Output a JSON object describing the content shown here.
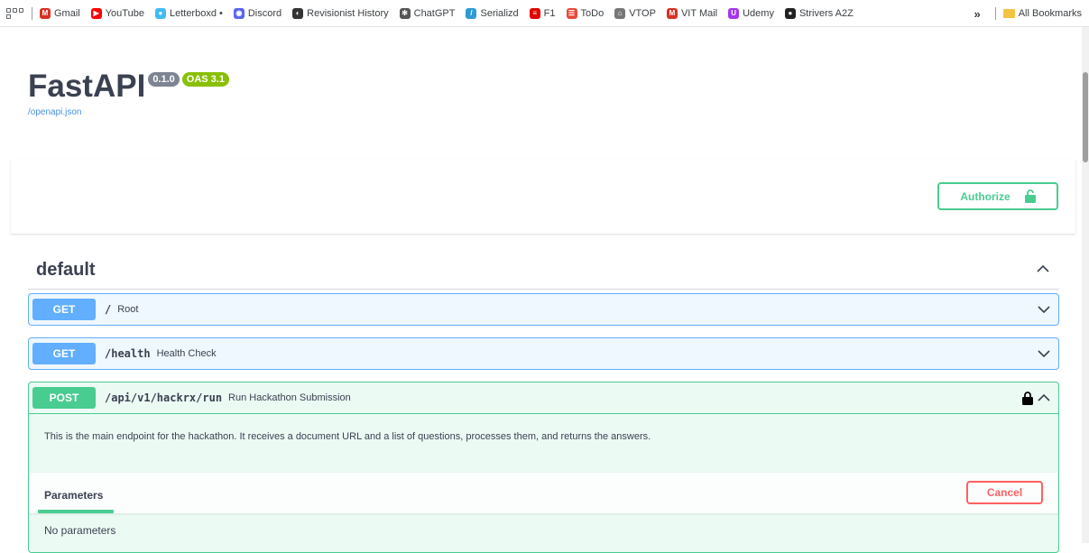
{
  "bookmarks": {
    "items": [
      {
        "label": "Gmail",
        "icon": "gmail-icon",
        "color": "#d93025",
        "glyph": "M"
      },
      {
        "label": "YouTube",
        "icon": "youtube-icon",
        "color": "#ff0000",
        "glyph": "▶"
      },
      {
        "label": "Letterboxd •",
        "icon": "letterboxd-icon",
        "color": "#40bcf4",
        "glyph": "●"
      },
      {
        "label": "Discord",
        "icon": "discord-icon",
        "color": "#5865f2",
        "glyph": "◉"
      },
      {
        "label": "Revisionist History",
        "icon": "podcast-icon",
        "color": "#333333",
        "glyph": "◐"
      },
      {
        "label": "ChatGPT",
        "icon": "chatgpt-icon",
        "color": "#555555",
        "glyph": "✻"
      },
      {
        "label": "Serializd",
        "icon": "serializd-icon",
        "color": "#2e9bd6",
        "glyph": "/"
      },
      {
        "label": "F1",
        "icon": "f1-icon",
        "color": "#e10600",
        "glyph": "≡"
      },
      {
        "label": "ToDo",
        "icon": "todo-icon",
        "color": "#e84a3b",
        "glyph": "☰"
      },
      {
        "label": "VTOP",
        "icon": "vtop-icon",
        "color": "#777777",
        "glyph": "⌂"
      },
      {
        "label": "VIT Mail",
        "icon": "gmail-icon",
        "color": "#d93025",
        "glyph": "M"
      },
      {
        "label": "Udemy",
        "icon": "udemy-icon",
        "color": "#a435f0",
        "glyph": "U"
      },
      {
        "label": "Strivers A2Z",
        "icon": "strivers-icon",
        "color": "#222222",
        "glyph": "●"
      }
    ],
    "overflow": "»",
    "all_bookmarks": "All Bookmarks"
  },
  "info": {
    "title": "FastAPI",
    "version": "0.1.0",
    "oas": "OAS 3.1",
    "spec_link": "/openapi.json"
  },
  "scheme": {
    "authorize_label": "Authorize"
  },
  "tag": {
    "name": "default"
  },
  "operations": [
    {
      "method": "GET",
      "path": "/",
      "summary": "Root"
    },
    {
      "method": "GET",
      "path": "/health",
      "summary": "Health Check"
    },
    {
      "method": "POST",
      "path": "/api/v1/hackrx/run",
      "summary": "Run Hackathon Submission",
      "description": "This is the main endpoint for the hackathon. It receives a document URL and a list of questions, processes them, and returns the answers.",
      "parameters_tab": "Parameters",
      "cancel_label": "Cancel",
      "no_parameters": "No parameters"
    }
  ],
  "colors": {
    "get": "#61affe",
    "post": "#49cc90",
    "cancel": "#ff6060",
    "version_badge": "#7d8492",
    "oas_badge": "#89bf04"
  }
}
